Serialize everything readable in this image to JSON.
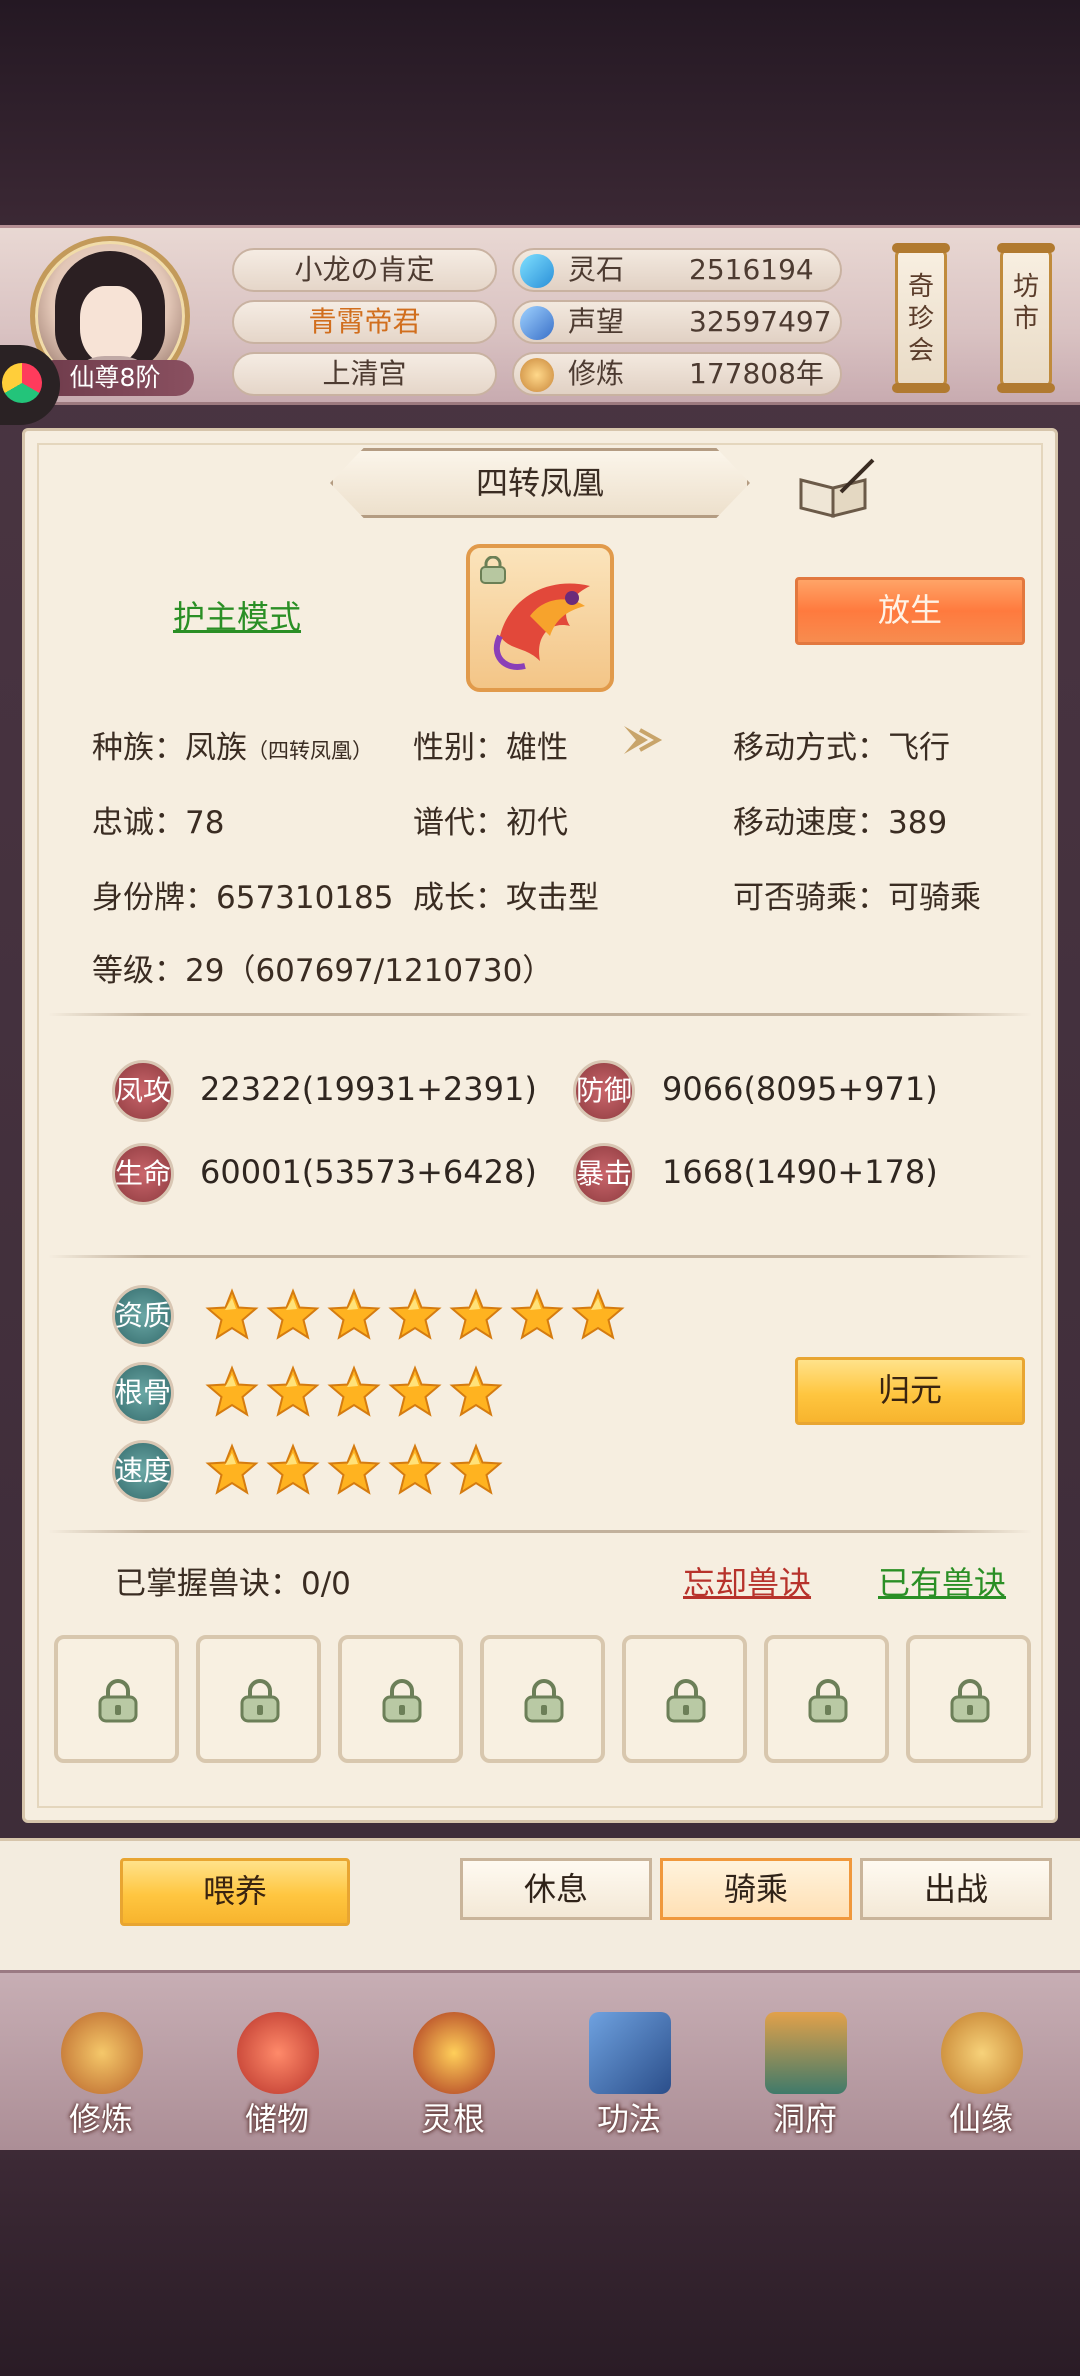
{
  "header": {
    "rank": "仙尊8阶",
    "names": [
      "小龙の肯定",
      "青霄帝君",
      "上清宫"
    ],
    "resources": [
      {
        "label": "灵石",
        "value": "2516194",
        "icon": "gem-icon"
      },
      {
        "label": "声望",
        "value": "32597497",
        "icon": "crystal-icon"
      },
      {
        "label": "修炼",
        "value": "177808年",
        "icon": "meditation-icon"
      }
    ],
    "scrolls": [
      "奇珍会",
      "坊市"
    ]
  },
  "pet": {
    "name": "四转凤凰",
    "mode_link": "护主模式",
    "release_button": "放生",
    "info": {
      "race_label": "种族：凤族",
      "race_sub": "（四转凤凰）",
      "gender": "性别：雄性",
      "move_mode": "移动方式：飞行",
      "loyalty": "忠诚：78",
      "generation": "谱代：初代",
      "move_speed": "移动速度：389",
      "id_tag": "身份牌：657310185",
      "growth": "成长：攻击型",
      "rideable": "可否骑乘：可骑乘",
      "level": "等级：29（607697/1210730）"
    },
    "stats": [
      {
        "badge": "凤攻",
        "value": "22322(19931+2391)"
      },
      {
        "badge": "防御",
        "value": "9066(8095+971)"
      },
      {
        "badge": "生命",
        "value": "60001(53573+6428)"
      },
      {
        "badge": "暴击",
        "value": "1668(1490+178)"
      }
    ],
    "ratings": [
      {
        "badge": "资质",
        "stars": 7
      },
      {
        "badge": "根骨",
        "stars": 5
      },
      {
        "badge": "速度",
        "stars": 5
      }
    ],
    "reset_button": "归元",
    "skills_label": "已掌握兽诀：0/0",
    "forget_link": "忘却兽诀",
    "owned_link": "已有兽诀",
    "skill_slots": 7
  },
  "actions": {
    "feed": "喂养",
    "tabs": [
      "休息",
      "骑乘",
      "出战"
    ],
    "active_tab": "骑乘"
  },
  "nav": [
    "修炼",
    "储物",
    "灵根",
    "功法",
    "洞府",
    "仙缘"
  ],
  "colors": {
    "accent_orange": "#ff7a3e",
    "accent_gold": "#ffc640",
    "link_green": "#2a8f25",
    "link_red": "#b7322b"
  }
}
